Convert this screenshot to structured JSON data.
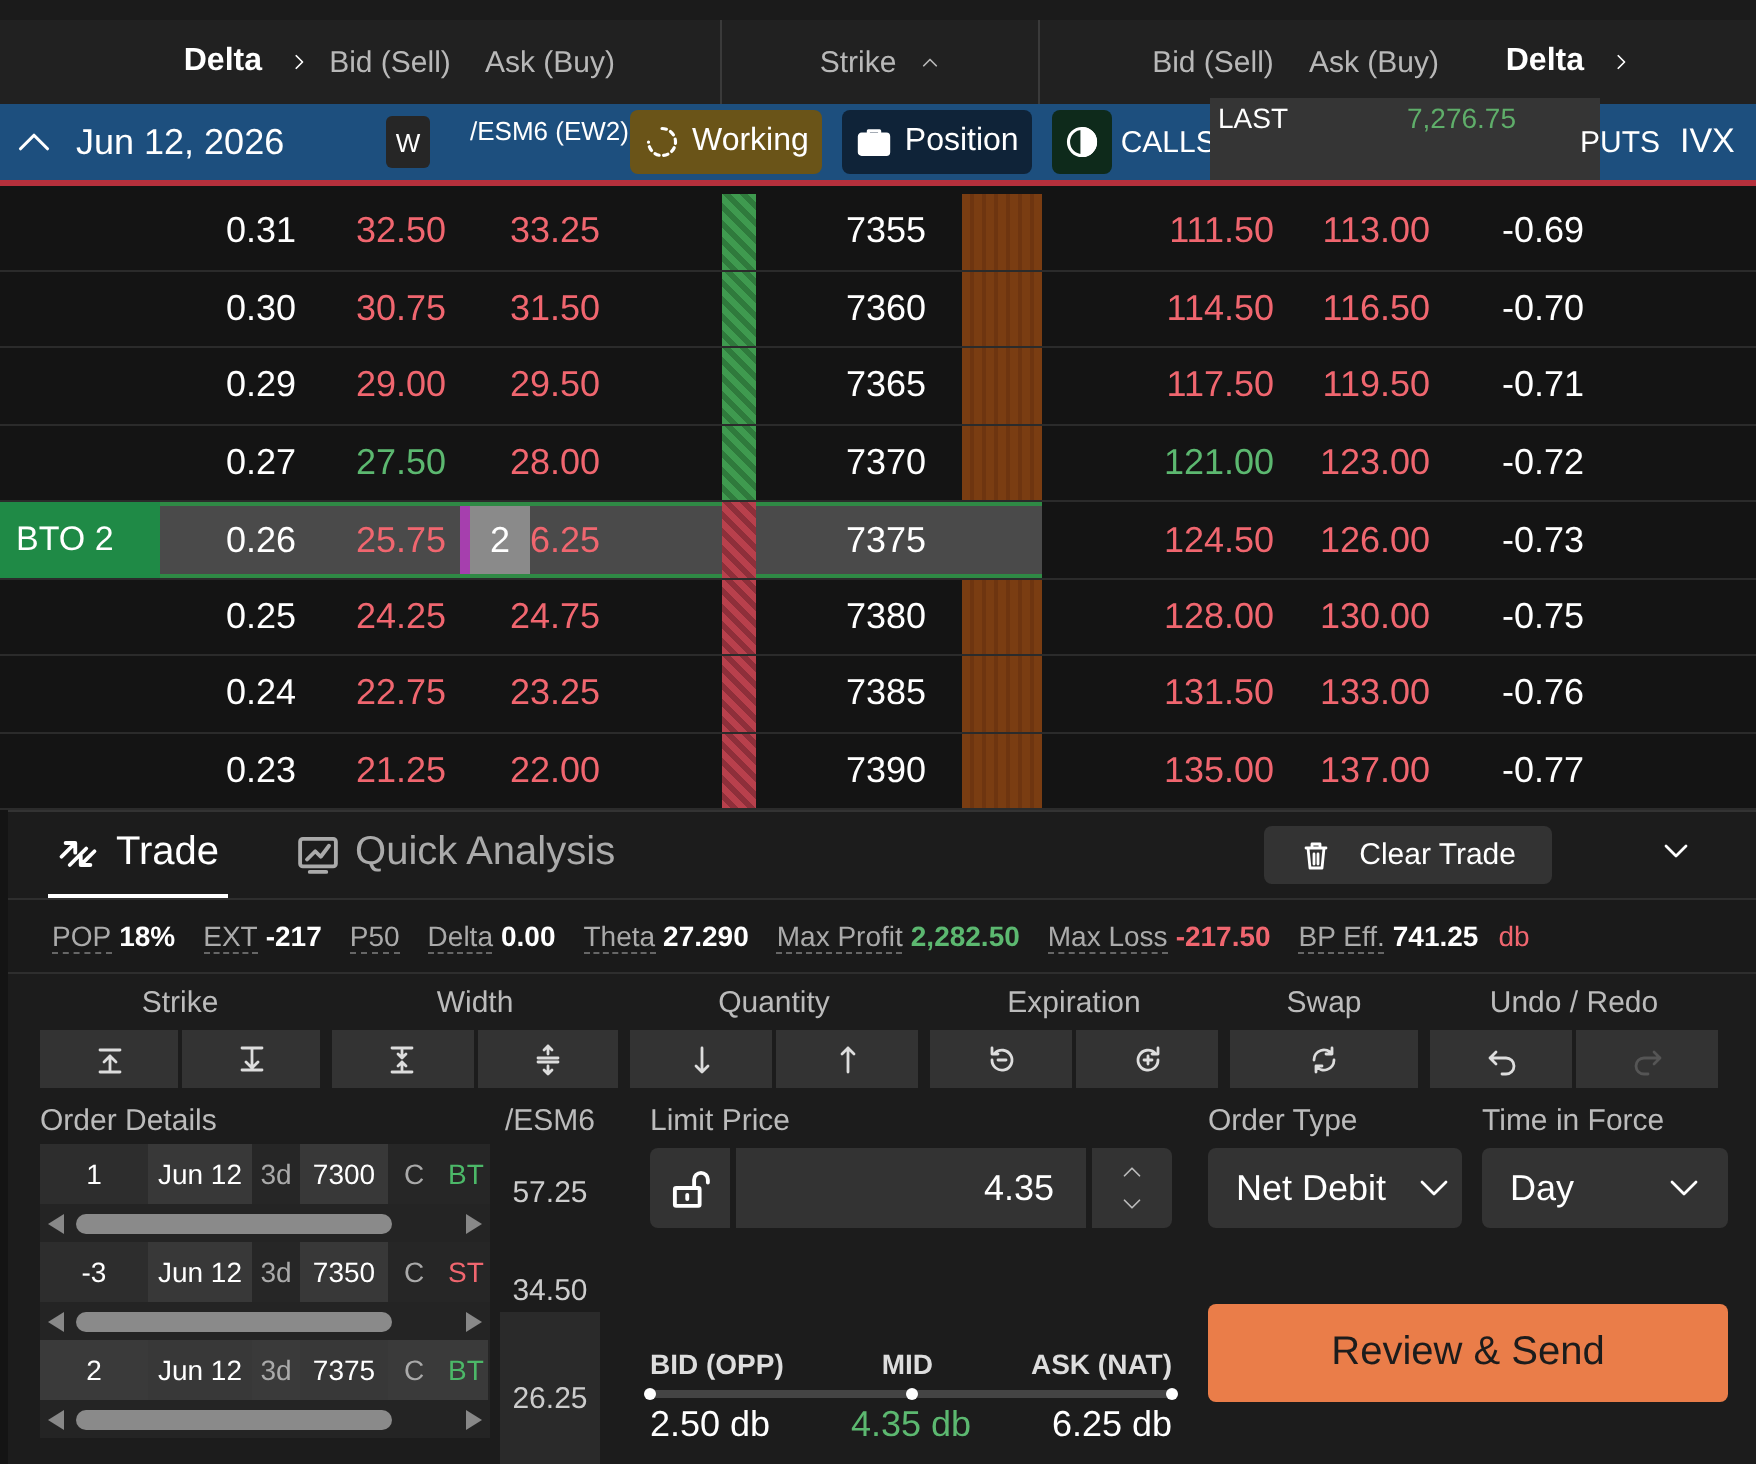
{
  "header": {
    "call_columns": [
      {
        "label": "Delta",
        "kind": "sort"
      },
      {
        "label": "Bid (Sell)",
        "kind": "plain"
      },
      {
        "label": "Ask (Buy)",
        "kind": "plain"
      }
    ],
    "strike": "Strike",
    "put_columns": [
      {
        "label": "Bid (Sell)",
        "kind": "plain"
      },
      {
        "label": "Ask (Buy)",
        "kind": "plain"
      },
      {
        "label": "Delta",
        "kind": "sort"
      }
    ]
  },
  "expiry_bar": {
    "date": "Jun 12, 2026",
    "badge": "W",
    "symbol": "/ESM6 (EW2)",
    "buttons": [
      {
        "label": "Working",
        "kind": "working"
      },
      {
        "label": "Position",
        "kind": "position"
      },
      {
        "kind": "contrast"
      }
    ],
    "calls": "CALLS",
    "puts": "PUTS",
    "ivx": "IVX",
    "last": {
      "label": "LAST",
      "value": "7,276.75"
    }
  },
  "rows": [
    {
      "strike": "7355",
      "call_delta": "0.31",
      "call_bid": "32.50",
      "call_bid_up": false,
      "call_ask": "33.25",
      "call_ask_up": false,
      "put_bid": "111.50",
      "put_bid_up": false,
      "put_ask": "113.00",
      "put_ask_up": false,
      "put_delta": "-0.69",
      "above_last": true,
      "selected": false
    },
    {
      "strike": "7360",
      "call_delta": "0.30",
      "call_bid": "30.75",
      "call_bid_up": false,
      "call_ask": "31.50",
      "call_ask_up": false,
      "put_bid": "114.50",
      "put_bid_up": false,
      "put_ask": "116.50",
      "put_ask_up": false,
      "put_delta": "-0.70",
      "above_last": true,
      "selected": false
    },
    {
      "strike": "7365",
      "call_delta": "0.29",
      "call_bid": "29.00",
      "call_bid_up": false,
      "call_ask": "29.50",
      "call_ask_up": false,
      "put_bid": "117.50",
      "put_bid_up": false,
      "put_ask": "119.50",
      "put_ask_up": false,
      "put_delta": "-0.71",
      "above_last": true,
      "selected": false
    },
    {
      "strike": "7370",
      "call_delta": "0.27",
      "call_bid": "27.50",
      "call_bid_up": true,
      "call_ask": "28.00",
      "call_ask_up": false,
      "put_bid": "121.00",
      "put_bid_up": true,
      "put_ask": "123.00",
      "put_ask_up": false,
      "put_delta": "-0.72",
      "above_last": true,
      "selected": false
    },
    {
      "strike": "7375",
      "call_delta": "0.26",
      "call_bid": "25.75",
      "call_bid_up": false,
      "call_ask": "6.25",
      "call_ask_up": false,
      "order_qty": "2",
      "order_label": "BTO 2",
      "put_bid": "124.50",
      "put_bid_up": false,
      "put_ask": "126.00",
      "put_ask_up": false,
      "put_delta": "-0.73",
      "above_last": false,
      "selected": true
    },
    {
      "strike": "7380",
      "call_delta": "0.25",
      "call_bid": "24.25",
      "call_bid_up": false,
      "call_ask": "24.75",
      "call_ask_up": false,
      "put_bid": "128.00",
      "put_bid_up": false,
      "put_ask": "130.00",
      "put_ask_up": false,
      "put_delta": "-0.75",
      "above_last": false,
      "selected": false
    },
    {
      "strike": "7385",
      "call_delta": "0.24",
      "call_bid": "22.75",
      "call_bid_up": false,
      "call_ask": "23.25",
      "call_ask_up": false,
      "put_bid": "131.50",
      "put_bid_up": false,
      "put_ask": "133.00",
      "put_ask_up": false,
      "put_delta": "-0.76",
      "above_last": false,
      "selected": false
    },
    {
      "strike": "7390",
      "call_delta": "0.23",
      "call_bid": "21.25",
      "call_bid_up": false,
      "call_ask": "22.00",
      "call_ask_up": false,
      "put_bid": "135.00",
      "put_bid_up": false,
      "put_ask": "137.00",
      "put_ask_up": false,
      "put_delta": "-0.77",
      "above_last": false,
      "selected": false
    }
  ],
  "panel": {
    "tabs": [
      {
        "label": "Trade",
        "kind": "trade",
        "selected": true
      },
      {
        "label": "Quick Analysis",
        "kind": "analysis",
        "selected": false
      }
    ],
    "clear_button": "Clear Trade",
    "stats": [
      {
        "label": "POP",
        "value": "18%",
        "color": "#ffffff"
      },
      {
        "label": "EXT",
        "value": "-217",
        "color": "#ffffff"
      },
      {
        "label": "P50"
      },
      {
        "label": "Delta",
        "value": "0.00",
        "color": "#ffffff"
      },
      {
        "label": "Theta",
        "value": "27.290",
        "color": "#ffffff"
      },
      {
        "label": "Max Profit",
        "value": "2,282.50",
        "color": "#5cb870"
      },
      {
        "label": "Max Loss",
        "value": "-217.50",
        "color": "#f0666f"
      },
      {
        "label": "BP Eff.",
        "value": "741.25",
        "unit": "db",
        "color": "#ffffff"
      }
    ],
    "control_groups": [
      {
        "label": "Strike",
        "buttons": [
          {
            "kind": "strike-up",
            "disabled": false
          },
          {
            "kind": "strike-down",
            "disabled": false
          }
        ]
      },
      {
        "label": "Width",
        "buttons": [
          {
            "kind": "width-in",
            "disabled": false
          },
          {
            "kind": "width-out",
            "disabled": false
          }
        ]
      },
      {
        "label": "Quantity",
        "buttons": [
          {
            "kind": "qty-down",
            "disabled": false
          },
          {
            "kind": "qty-up",
            "disabled": false
          }
        ]
      },
      {
        "label": "Expiration",
        "buttons": [
          {
            "kind": "exp-back",
            "disabled": false
          },
          {
            "kind": "exp-forward",
            "disabled": false
          }
        ]
      },
      {
        "label": "Swap",
        "buttons": [
          {
            "kind": "swap",
            "disabled": false
          }
        ]
      },
      {
        "label": "Undo / Redo",
        "buttons": [
          {
            "kind": "undo",
            "disabled": false
          },
          {
            "kind": "redo",
            "disabled": true
          }
        ]
      }
    ],
    "order_details": {
      "title": "Order Details",
      "symbol": "/ESM6",
      "legs": [
        {
          "qty": "1",
          "date": "Jun 12",
          "dte": "3d",
          "strike": "7300",
          "type": "C",
          "action": "BT",
          "color": "#4cb868",
          "price": "57.25",
          "selected": false
        },
        {
          "qty": "-3",
          "date": "Jun 12",
          "dte": "3d",
          "strike": "7350",
          "type": "C",
          "action": "ST",
          "color": "#f0666f",
          "price": "34.50",
          "selected": false
        },
        {
          "qty": "2",
          "date": "Jun 12",
          "dte": "3d",
          "strike": "7375",
          "type": "C",
          "action": "BT",
          "color": "#4cb868",
          "price": "26.25",
          "selected": true
        }
      ]
    },
    "limit_price": {
      "label": "Limit Price",
      "value": "4.35"
    },
    "order_type": {
      "label": "Order Type",
      "value": "Net Debit"
    },
    "time_in_force": {
      "label": "Time in Force",
      "value": "Day"
    },
    "price_range": {
      "level": 0.5,
      "points": [
        {
          "label": "BID (OPP)",
          "value": "2.50 db",
          "highlighted": false
        },
        {
          "label": "MID",
          "value": "4.35 db",
          "highlighted": true
        },
        {
          "label": "ASK (NAT)",
          "value": "6.25 db",
          "highlighted": false
        }
      ]
    },
    "send_button": "Review & Send"
  }
}
